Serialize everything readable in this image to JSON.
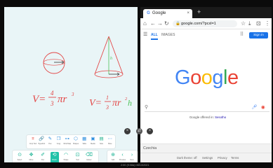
{
  "whiteboard": {
    "formula_left": [
      "V=",
      "4",
      "3",
      "πr",
      "3"
    ],
    "formula_right": [
      "V=",
      "1",
      "3",
      "πr",
      "2",
      "h"
    ],
    "tools_top": [
      {
        "icon": "crop-icon",
        "glyph": "⌗",
        "label": "Crop Tool",
        "color": "#e8584c"
      },
      {
        "icon": "link-icon",
        "glyph": "🔗",
        "label": "Hyperlink",
        "color": "#2f8fde"
      },
      {
        "icon": "pen-icon",
        "glyph": "✎",
        "label": "Pen",
        "color": "#2f8fde"
      },
      {
        "icon": "copy-icon",
        "glyph": "❐",
        "label": "Copy",
        "color": "#2f8fde"
      },
      {
        "icon": "mindmap-icon",
        "glyph": "⊶",
        "label": "Mind Map",
        "color": "#2f8fde"
      },
      {
        "icon": "shape-icon",
        "glyph": "⬡",
        "label": "Shapes",
        "color": "#2f8fde"
      },
      {
        "icon": "table-icon",
        "glyph": "▦",
        "label": "Table",
        "color": "#2f8fde"
      },
      {
        "icon": "media-icon",
        "glyph": "▣",
        "label": "Media",
        "color": "#2f8fde"
      },
      {
        "icon": "sticky-note-icon",
        "glyph": "▤",
        "label": "Note",
        "color": "#21b08c"
      },
      {
        "icon": "more-icon",
        "glyph": "⋯",
        "label": "More",
        "color": "#2f8fde"
      }
    ],
    "tools_bottom": [
      {
        "icon": "select-icon",
        "glyph": "⊙",
        "label": "Select",
        "active": false
      },
      {
        "icon": "move-icon",
        "glyph": "✥",
        "label": "Move",
        "active": false
      },
      {
        "icon": "pen-tool-icon",
        "glyph": "✐",
        "label": "Pen",
        "active": false
      },
      {
        "icon": "brush-icon",
        "glyph": "⟲",
        "label": "Brush",
        "active": true
      },
      {
        "icon": "shape-tool-icon",
        "glyph": "◠",
        "label": "Shape",
        "active": false
      },
      {
        "icon": "text-icon",
        "glyph": "⊡",
        "label": "Text",
        "active": false
      },
      {
        "icon": "eraser-icon",
        "glyph": "⌫",
        "label": "Eraser",
        "active": false
      }
    ],
    "tools_right": [
      {
        "icon": "add-page-icon",
        "glyph": "⊕",
        "label": "Add"
      },
      {
        "icon": "prev-page-icon",
        "glyph": "‹",
        "label": "Previous"
      },
      {
        "icon": "next-page-icon",
        "glyph": "›",
        "label": "Next"
      }
    ]
  },
  "browser": {
    "tab_title": "Google",
    "tab_close": "×",
    "new_tab": "+",
    "url": "google.com/?pcxl=1",
    "nav_all": "ALL",
    "nav_images": "IMAGES",
    "sign_in": "Sign in",
    "logo_letters": [
      {
        "ch": "G",
        "color": "#4285f4"
      },
      {
        "ch": "o",
        "color": "#ea4335"
      },
      {
        "ch": "o",
        "color": "#fbbc05"
      },
      {
        "ch": "g",
        "color": "#4285f4"
      },
      {
        "ch": "l",
        "color": "#34a853"
      },
      {
        "ch": "e",
        "color": "#ea4335"
      }
    ],
    "offered_prefix": "Google offered in:",
    "offered_language": "Sesotho",
    "footer_location": "Czechia",
    "footer_links": [
      "Dark theme: off",
      "Settings",
      "Privacy",
      "Terms"
    ]
  },
  "controls": {
    "close_glyph": "×",
    "swap_glyph": "⇄"
  },
  "taskbar": {
    "clock": "2:00 (9:08a) 08/13/2021"
  }
}
